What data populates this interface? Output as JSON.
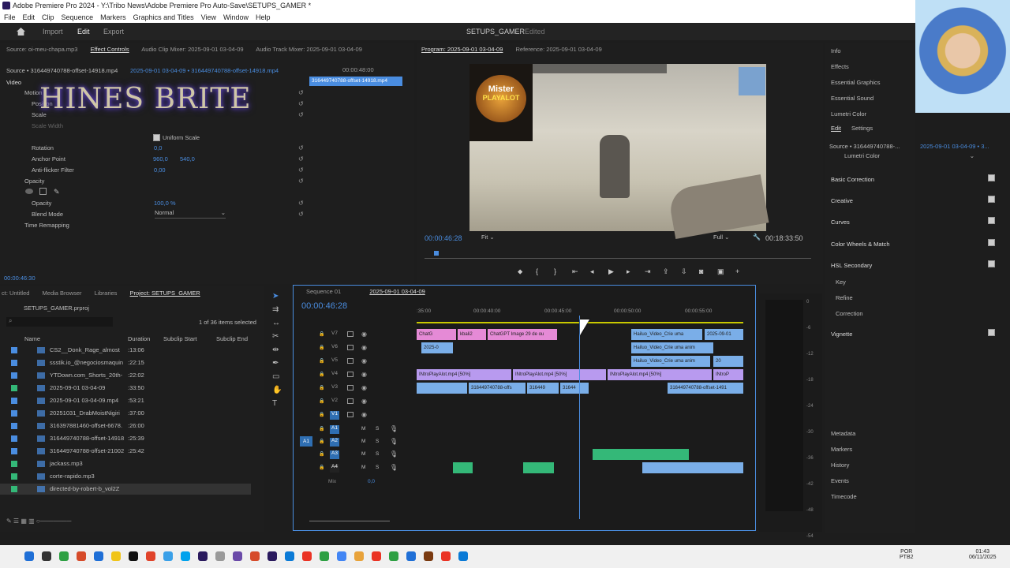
{
  "window": {
    "title": "Adobe Premiere Pro 2024 - Y:\\Tribo News\\Adobe Premiere Pro Auto-Save\\SETUPS_GAMER *"
  },
  "menu": [
    "File",
    "Edit",
    "Clip",
    "Sequence",
    "Markers",
    "Graphics and Titles",
    "View",
    "Window",
    "Help"
  ],
  "workspace": {
    "tabs": [
      "Import",
      "Edit",
      "Export"
    ],
    "project": "SETUPS_GAMER",
    "status": "Edited"
  },
  "source_panel": {
    "tabs": [
      "Source: oi-meu-chapa.mp3",
      "Effect Controls",
      "Audio Clip Mixer: 2025-09-01 03-04-09",
      "Audio Track Mixer: 2025-09-01 03-04-09"
    ],
    "source_clip": "Source • 316449740788-offset-14918.mp4",
    "seq_clip": "2025-09-01 03-04-09 • 316449740788-offset-14918.mp4",
    "timecode": "00:00:48:00",
    "mini_clip": "316449740788-offset-14918.mp4",
    "video_label": "Video",
    "motion": "Motion",
    "position": "Position",
    "scale": "Scale",
    "scale_width": "Scale Width",
    "uniform_scale": "Uniform Scale",
    "rotation": "Rotation",
    "rotation_val": "0,0",
    "anchor": "Anchor Point",
    "anchor_x": "960,0",
    "anchor_y": "540,0",
    "flicker": "Anti-flicker Filter",
    "flicker_val": "0,00",
    "opacity": "Opacity",
    "opacity_prop": "Opacity",
    "opacity_val": "100,0 %",
    "blend": "Blend Mode",
    "blend_val": "Normal",
    "time_remap": "Time Remapping",
    "current_time": "00:00:46:30",
    "overlay": "HINES BRITE"
  },
  "program": {
    "tab": "Program: 2025-09-01 03-04-09",
    "ref": "Reference: 2025-09-01 03-04-09",
    "timecode": "00:00:46:28",
    "fit": "Fit",
    "full": "Full",
    "duration": "00:18:33:50",
    "logo1": "Mister",
    "logo2": "PLAYALOT"
  },
  "right_panel": {
    "items": [
      "Info",
      "Effects",
      "Essential Graphics",
      "Essential Sound",
      "Lumetri Color"
    ],
    "tabs": [
      "Edit",
      "Settings"
    ],
    "source": "Source • 316449740788-...",
    "seq": "2025-09-01 03-04-09 • 3...",
    "effect": "Lumetri Color",
    "sections": [
      "Basic Correction",
      "Creative",
      "Curves",
      "Color Wheels & Match",
      "HSL Secondary"
    ],
    "subs": [
      "Key",
      "Refine",
      "Correction"
    ],
    "vignette": "Vignette",
    "bottom": [
      "Metadata",
      "Markers",
      "History",
      "Events",
      "Timecode"
    ]
  },
  "project": {
    "tabs": [
      "ct: Untitled",
      "Media Browser",
      "Libraries",
      "Project: SETUPS_GAMER"
    ],
    "file": "SETUPS_GAMER.prproj",
    "count": "1 of 36 items selected",
    "cols": [
      "Name",
      "Duration",
      "Subclip Start",
      "Subclip End"
    ],
    "rows": [
      {
        "name": "CS2__Donk_Rage_almost",
        "dur": ":13:06",
        "color": "#4a8de0"
      },
      {
        "name": "ssstik.io_@negociosmaquin",
        "dur": ":22:15",
        "color": "#4a8de0"
      },
      {
        "name": "YTDown.com_Shorts_20th-",
        "dur": ":22:02",
        "color": "#4a8de0"
      },
      {
        "name": "2025-09-01 03-04-09",
        "dur": ":33:50",
        "color": "#34b878"
      },
      {
        "name": "2025-09-01 03-04-09.mp4",
        "dur": ":53:21",
        "color": "#4a8de0"
      },
      {
        "name": "20251031_DrabMoistNigiri",
        "dur": ":37:00",
        "color": "#4a8de0"
      },
      {
        "name": "316397881460-offset-6678.",
        "dur": ":26:00",
        "color": "#4a8de0"
      },
      {
        "name": "316449740788-offset-14918",
        "dur": ":25:39",
        "color": "#4a8de0"
      },
      {
        "name": "316449740788-offset-21002",
        "dur": ":25:42",
        "color": "#4a8de0"
      },
      {
        "name": "jackass.mp3",
        "dur": "",
        "color": "#34b878"
      },
      {
        "name": "corte-rapido.mp3",
        "dur": "",
        "color": "#34b878"
      },
      {
        "name": "directed-by-robert-b_vol2Z",
        "dur": "",
        "color": "#34b878"
      }
    ]
  },
  "timeline": {
    "tabs": [
      "Sequence 01",
      "2025-09-01 03-04-09"
    ],
    "timecode": "00:00:46:28",
    "ruler": [
      ":35:00",
      "00:00:40:00",
      "00:00:45:00",
      "00:00:50:00",
      "00:00:55:00"
    ],
    "video_tracks": [
      "V7",
      "V6",
      "V5",
      "V4",
      "V3",
      "V2",
      "V1"
    ],
    "audio_tracks": [
      "A1",
      "A2",
      "A3",
      "A4"
    ],
    "mix": "Mix",
    "mix_val": "0,0",
    "src_a1": "A1",
    "src_v1": "V1",
    "clips": {
      "c1": "ChatG",
      "c2": "kbali2",
      "c3": "ChatGPT Image 29 de ou",
      "c4": "2025-0",
      "c5": "Hailuo_Video_Crie uma",
      "c6": "2025-09-01",
      "c7": "Hailuo_Video_Crie uma anim",
      "c8": "Hailuo_Video_Crie uma anim",
      "c9": "20",
      "c10": "INtroPlayAlot.mp4 [50%]",
      "c11": "INtroPlayAlot.mp4 [50%]",
      "c12": "INtroPlayAlot.mp4 [50%]",
      "c13": "INtroP",
      "c14": "316449740788-offs",
      "c15": "316449",
      "c16": "31644",
      "c17": "316449740788-offset-1491"
    }
  },
  "meter": [
    "0",
    "-6",
    "-12",
    "-18",
    "-24",
    "-30",
    "-36",
    "-42",
    "-48",
    "-54"
  ],
  "tray": {
    "lang": "POR",
    "kbd": "PTB2",
    "time": "01:43",
    "date": "06/11/2025"
  }
}
